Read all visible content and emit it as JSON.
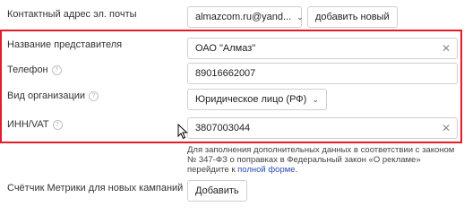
{
  "contact_email": {
    "label": "Контактный адрес эл. почты",
    "value": "almazcom.ru@yand...",
    "add_button": "добавить новый"
  },
  "representative": {
    "label": "Название представителя",
    "value": "ОАО \"Алмаз\""
  },
  "phone": {
    "label": "Телефон",
    "value": "89016662007"
  },
  "org_type": {
    "label": "Вид организации",
    "value": "Юридическое лицо (РФ)"
  },
  "inn": {
    "label": "ИНН/VAT",
    "value": "3807003044"
  },
  "note": {
    "text": "Для заполнения дополнительных данных в соответствии с законом № 347-ФЗ о поправках в Федеральный закон «О рекламе» перейдите к ",
    "link": "полной форме",
    "end": "."
  },
  "metrika": {
    "label": "Счётчик Метрики для новых кампаний",
    "button": "Добавить"
  },
  "icons": {
    "help": "?",
    "clear": "✕",
    "chevron": "⌄"
  },
  "colors": {
    "highlight_border": "#e41d2a",
    "link": "#2c4db5"
  }
}
